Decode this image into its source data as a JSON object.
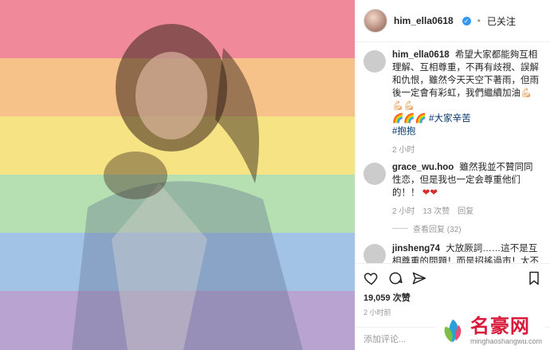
{
  "header": {
    "username": "him_ella0618",
    "separator": "•",
    "follow_status": "已关注"
  },
  "caption": {
    "username": "him_ella0618",
    "text": "希望大家都能夠互相理解、互相尊重，不再有歧視、誤解和仇恨，雖然今天天空下著雨，但雨後一定會有彩虹，我們繼續加油💪🏻💪🏻💪🏻",
    "emojis": "🌈🌈🌈",
    "tag1": "#大家辛苦",
    "tag2": "#抱抱",
    "time": "2 小时"
  },
  "comments": [
    {
      "username": "grace_wu.hoo",
      "text": "雖然我並不贊同同性恋，但是我也一定会尊重他们的！！",
      "hearts": "❤❤",
      "time": "2 小时",
      "likes": "13 次赞",
      "reply": "回复",
      "view_replies": "查看回复 (32)"
    },
    {
      "username": "jinsheng74",
      "text": "大放厥詞……這不是互相尊重的問題！而是招搖過市！太不尊重他人存在！你們的存在我們"
    }
  ],
  "actions": {
    "likes": "19,059 次赞",
    "time": "2 小时前",
    "add_comment_placeholder": "添加评论..."
  },
  "watermark": {
    "title": "名豪网",
    "subtitle": "minghaoshangwu.com"
  },
  "colors": {
    "verified": "#3897f0",
    "hashtag": "#003569",
    "watermark_red": "#d9193a"
  }
}
